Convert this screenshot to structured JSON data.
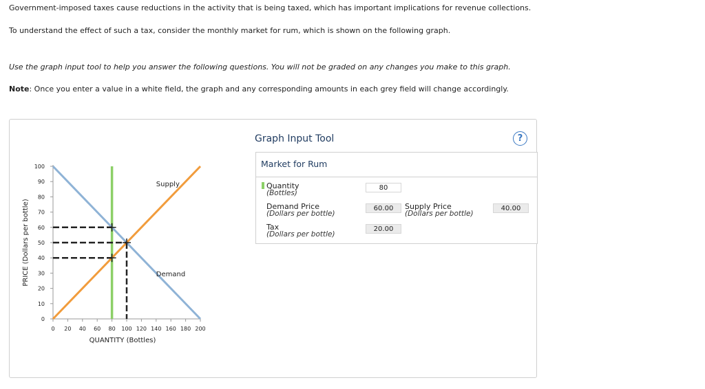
{
  "intro": {
    "line1": "Government-imposed taxes cause reductions in the activity that is being taxed, which has important implications for revenue collections.",
    "line2": "To understand the effect of such a tax, consider the monthly market for rum, which is shown on the following graph.",
    "instructions": "Use the graph input tool to help you answer the following questions. You will not be graded on any changes you make to this graph.",
    "note_label": "Note",
    "note_text": ": Once you enter a value in a white field, the graph and any corresponding amounts in each grey field will change accordingly."
  },
  "tool": {
    "title": "Graph Input Tool",
    "help_symbol": "?",
    "market_title": "Market for Rum",
    "quantity_label": "Quantity",
    "quantity_unit": "(Bottles)",
    "quantity_value": "80",
    "demand_price_label": "Demand Price",
    "demand_price_unit": "(Dollars per bottle)",
    "demand_price_value": "60.00",
    "supply_price_label": "Supply Price",
    "supply_price_unit": "(Dollars per bottle)",
    "supply_price_value": "40.00",
    "tax_label": "Tax",
    "tax_unit": "(Dollars per bottle)",
    "tax_value": "20.00"
  },
  "colors": {
    "demand": "#8fb3d6",
    "supply": "#f19c3c",
    "quantity_line": "#8cd067",
    "dashed": "#222222",
    "axis": "#999999"
  },
  "chart_data": {
    "type": "line",
    "xlabel": "QUANTITY (Bottles)",
    "ylabel": "PRICE (Dollars per bottle)",
    "xlim": [
      0,
      200
    ],
    "ylim": [
      0,
      100
    ],
    "xticks": [
      0,
      20,
      40,
      60,
      80,
      100,
      120,
      140,
      160,
      180,
      200
    ],
    "yticks": [
      0,
      10,
      20,
      30,
      40,
      50,
      60,
      70,
      80,
      90,
      100
    ],
    "series": [
      {
        "name": "Demand",
        "points": [
          [
            0,
            100
          ],
          [
            200,
            0
          ]
        ],
        "label_at": [
          140,
          28
        ]
      },
      {
        "name": "Supply",
        "points": [
          [
            0,
            0
          ],
          [
            200,
            100
          ]
        ],
        "label_at": [
          140,
          87
        ]
      }
    ],
    "quantity_line": {
      "x": 80
    },
    "markers": [
      {
        "x": 80,
        "y": 60
      },
      {
        "x": 100,
        "y": 50
      },
      {
        "x": 80,
        "y": 40
      }
    ],
    "dashed_horizontal": [
      {
        "y": 60,
        "x_to": 80
      },
      {
        "y": 50,
        "x_to": 100
      },
      {
        "y": 40,
        "x_to": 80
      }
    ],
    "dashed_vertical": [
      {
        "x": 100,
        "y_to": 50
      }
    ]
  }
}
